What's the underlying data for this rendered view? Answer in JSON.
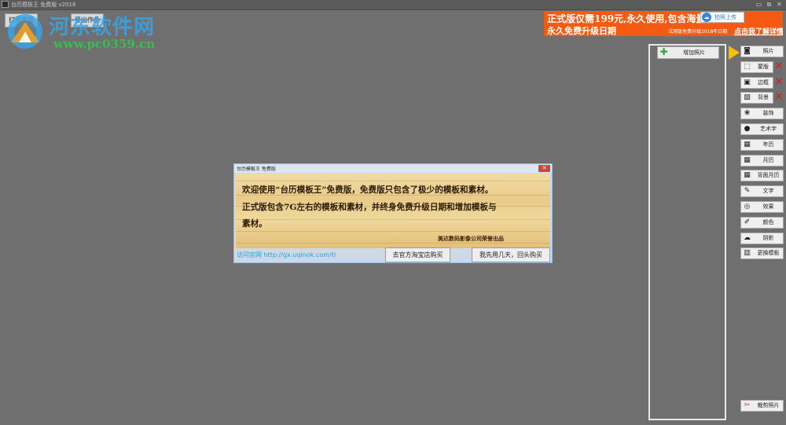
{
  "window": {
    "title": "台历模板王 免费版 v2018",
    "minimize": "▭",
    "restore": "⧉",
    "close": "✕"
  },
  "menubar": {
    "items": [
      {
        "label": "打开作品"
      },
      {
        "label": "导出作品"
      }
    ]
  },
  "watermark": {
    "brand": "河东软件网",
    "url": "www.pc0359.cn"
  },
  "promo": {
    "line1": "正式版仅需199元,永久使用,包含海量模",
    "line2": "永久免费升级日期",
    "note": "试用版免费升级2018年日期",
    "link": "点击我了解详情",
    "upload_button": "拍照上传"
  },
  "photo_panel": {
    "add_photo": "增加照片"
  },
  "tools": [
    {
      "label": "照片",
      "icon": "camera-icon",
      "glyph": "◙",
      "deletable": false
    },
    {
      "label": "蒙版",
      "icon": "mask-icon",
      "glyph": "⬚",
      "deletable": true
    },
    {
      "label": "边框",
      "icon": "frame-icon",
      "glyph": "▣",
      "deletable": true
    },
    {
      "label": "背景",
      "icon": "background-icon",
      "glyph": "▨",
      "deletable": true
    },
    {
      "label": "装饰",
      "icon": "decoration-icon",
      "glyph": "❀",
      "deletable": false
    },
    {
      "label": "艺术字",
      "icon": "art-text-icon",
      "glyph": "●",
      "deletable": false
    },
    {
      "label": "年历",
      "icon": "year-calendar-icon",
      "glyph": "▦",
      "deletable": false
    },
    {
      "label": "月历",
      "icon": "month-calendar-icon",
      "glyph": "▦",
      "deletable": false
    },
    {
      "label": "背面月历",
      "icon": "back-calendar-icon",
      "glyph": "▦",
      "deletable": false
    },
    {
      "label": "文字",
      "icon": "text-pen-icon",
      "glyph": "✎",
      "deletable": false
    },
    {
      "label": "效果",
      "icon": "effect-icon",
      "glyph": "◎",
      "deletable": false
    },
    {
      "label": "颜色",
      "icon": "color-brush-icon",
      "glyph": "✐",
      "deletable": false
    },
    {
      "label": "阴影",
      "icon": "shadow-icon",
      "glyph": "☁",
      "deletable": false
    },
    {
      "label": "更换模板",
      "icon": "template-icon",
      "glyph": "▥",
      "deletable": false
    }
  ],
  "delete_glyph": "✕",
  "save_photo": {
    "label": "裁剪照片",
    "glyph": "✂"
  },
  "dialog": {
    "title": "台历模板王 免费版",
    "close": "✕",
    "lines": [
      "欢迎使用“台历模板王”免费版，免费版只包含了极少的模板和素材。",
      "正式版包含7G左右的模板和素材，并终身免费升级日期和增加模板与",
      "素材。"
    ],
    "signature": "美达数码影像公司荣誉出品",
    "site_label": "访问官网 http://gx.uqinok.com/tl",
    "buy_button": "去官方淘宝店购买",
    "later_button": "我先用几天，回头购买"
  }
}
